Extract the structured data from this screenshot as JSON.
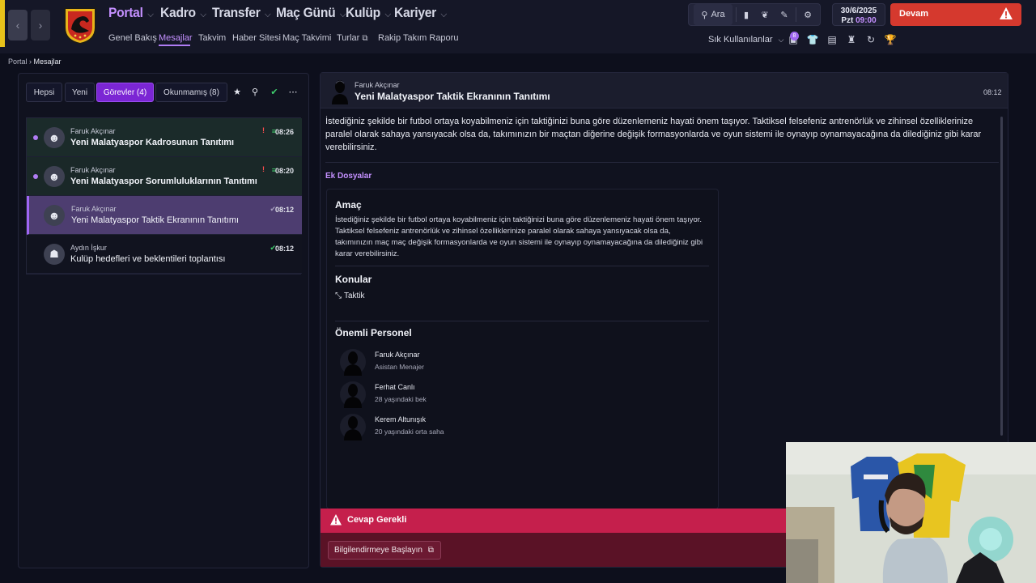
{
  "nav": {
    "main": [
      "Portal",
      "Kadro",
      "Transfer",
      "Maç Günü",
      "Kulüp",
      "Kariyer"
    ],
    "sub": [
      "Genel Bakış",
      "Mesajlar",
      "Takvim",
      "Haber Sitesi",
      "Maç Takvimi",
      "Turlar",
      "Rakip Takım Raporu"
    ]
  },
  "toolbar": {
    "search_label": "Ara"
  },
  "date": {
    "date": "30/6/2025",
    "day": "Pzt",
    "time": "09:00"
  },
  "continue_label": "Devam",
  "favorites_label": "Sık Kullanılanlar",
  "message_badge": "8",
  "breadcrumb": [
    "Portal",
    "Mesajlar"
  ],
  "filters": {
    "all": "Hepsi",
    "new": "Yeni",
    "tasks": "Görevler (4)",
    "unread": "Okunmamış (8)"
  },
  "messages": [
    {
      "sender": "Faruk Akçınar",
      "subject": "Yeni Malatyaspor Kadrosunun Tanıtımı",
      "time": "08:26"
    },
    {
      "sender": "Faruk Akçınar",
      "subject": "Yeni Malatyaspor Sorumluluklarının Tanıtımı",
      "time": "08:20"
    },
    {
      "sender": "Faruk Akçınar",
      "subject": "Yeni Malatyaspor Taktik Ekranının Tanıtımı",
      "time": "08:12"
    },
    {
      "sender": "Aydın İşkur",
      "subject": "Kulüp hedefleri ve beklentileri toplantısı",
      "time": "08:12"
    }
  ],
  "detail": {
    "sender": "Faruk Akçınar",
    "subject": "Yeni Malatyaspor Taktik Ekranının Tanıtımı",
    "time": "08:12",
    "body": "İstediğiniz şekilde bir futbol ortaya koyabilmeniz için taktiğinizi buna göre düzenlemeniz hayati önem taşıyor. Taktiksel felsefeniz antrenörlük ve zihinsel özelliklerinize paralel olarak sahaya yansıyacak olsa da, takımınızın bir maçtan diğerine değişik formasyonlarda ve oyun sistemi ile oynayıp oynamayacağına da dilediğiniz gibi karar verebilirsiniz.",
    "attachments_label": "Ek Dosyalar",
    "goal_title": "Amaç",
    "goal_text": "İstediğiniz şekilde bir futbol ortaya koyabilmeniz için taktiğinizi buna göre düzenlemeniz hayati önem taşıyor. Taktiksel felsefeniz antrenörlük ve zihinsel özelliklerinize paralel olarak sahaya yansıyacak olsa da, takımınızın maç maç değişik formasyonlarda ve oyun sistemi ile oynayıp oynamayacağına da dilediğiniz gibi karar verebilirsiniz.",
    "topics_title": "Konular",
    "topic": "Taktik",
    "staff_title": "Önemli Personel",
    "staff": [
      {
        "name": "Faruk Akçınar",
        "role": "Asistan Menajer"
      },
      {
        "name": "Ferhat Canlı",
        "role": "28 yaşındaki bek"
      },
      {
        "name": "Kerem Altunışık",
        "role": "20 yaşındaki orta saha"
      }
    ],
    "response_label": "Cevap Gerekli",
    "action_label": "Bilgilendirmeye Başlayın"
  }
}
